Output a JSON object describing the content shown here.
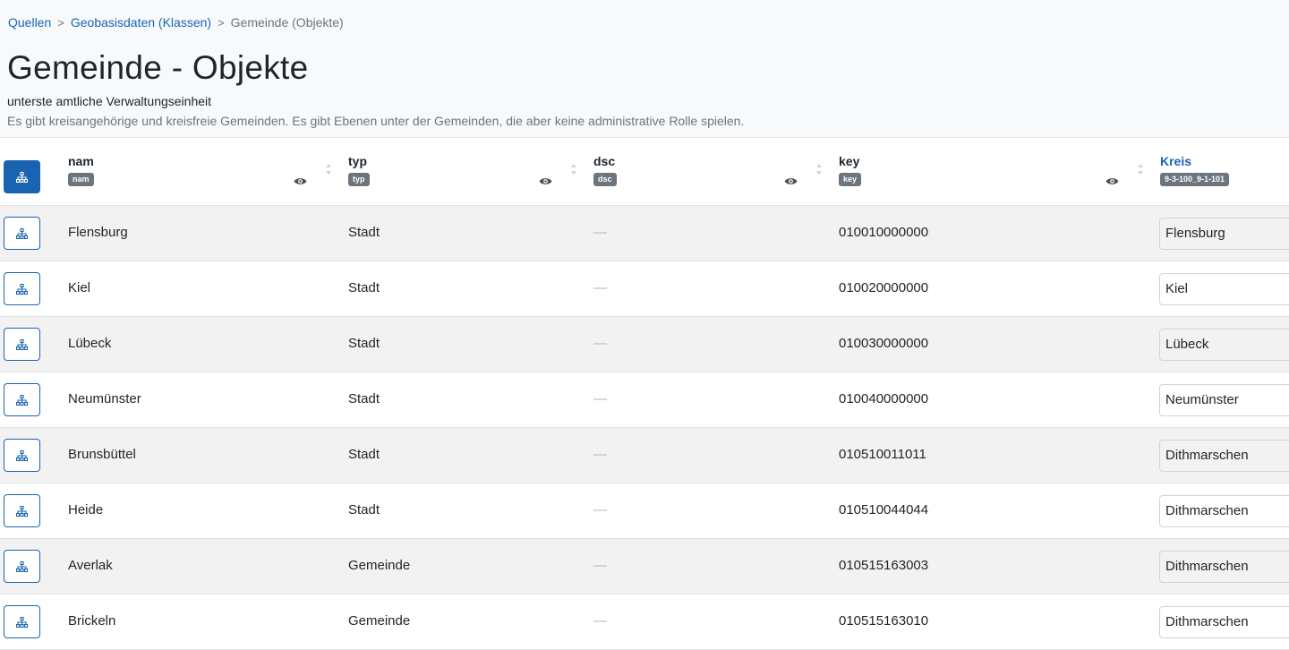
{
  "breadcrumb": {
    "items": [
      {
        "label": "Quellen"
      },
      {
        "label": "Geobasisdaten (Klassen)"
      }
    ],
    "current": "Gemeinde (Objekte)"
  },
  "page": {
    "title": "Gemeinde - Objekte",
    "subtitle": "unterste amtliche Verwaltungseinheit",
    "description": "Es gibt kreisangehörige und kreisfreie Gemeinden. Es gibt Ebenen unter der Gemeinden, die aber keine administrative Rolle spielen."
  },
  "columns": [
    {
      "label": "nam",
      "badge": "nam"
    },
    {
      "label": "typ",
      "badge": "typ"
    },
    {
      "label": "dsc",
      "badge": "dsc"
    },
    {
      "label": "key",
      "badge": "key"
    },
    {
      "label": "Kreis",
      "badge": "9-3-100_9-1-101"
    }
  ],
  "rows": [
    {
      "nam": "Flensburg",
      "typ": "Stadt",
      "dsc": "—",
      "key": "010010000000",
      "kreis": "Flensburg"
    },
    {
      "nam": "Kiel",
      "typ": "Stadt",
      "dsc": "—",
      "key": "010020000000",
      "kreis": "Kiel"
    },
    {
      "nam": "Lübeck",
      "typ": "Stadt",
      "dsc": "—",
      "key": "010030000000",
      "kreis": "Lübeck"
    },
    {
      "nam": "Neumünster",
      "typ": "Stadt",
      "dsc": "—",
      "key": "010040000000",
      "kreis": "Neumünster"
    },
    {
      "nam": "Brunsbüttel",
      "typ": "Stadt",
      "dsc": "—",
      "key": "010510011011",
      "kreis": "Dithmarschen"
    },
    {
      "nam": "Heide",
      "typ": "Stadt",
      "dsc": "—",
      "key": "010510044044",
      "kreis": "Dithmarschen"
    },
    {
      "nam": "Averlak",
      "typ": "Gemeinde",
      "dsc": "—",
      "key": "010515163003",
      "kreis": "Dithmarschen"
    },
    {
      "nam": "Brickeln",
      "typ": "Gemeinde",
      "dsc": "—",
      "key": "010515163010",
      "kreis": "Dithmarschen"
    }
  ],
  "icons": {
    "tree": "sitemap-icon",
    "sort": "sort-icon",
    "visibility": "eye-icon"
  },
  "colors": {
    "accent": "#1a63b0",
    "badge": "#6c757d",
    "stripe": "#f2f2f2"
  }
}
